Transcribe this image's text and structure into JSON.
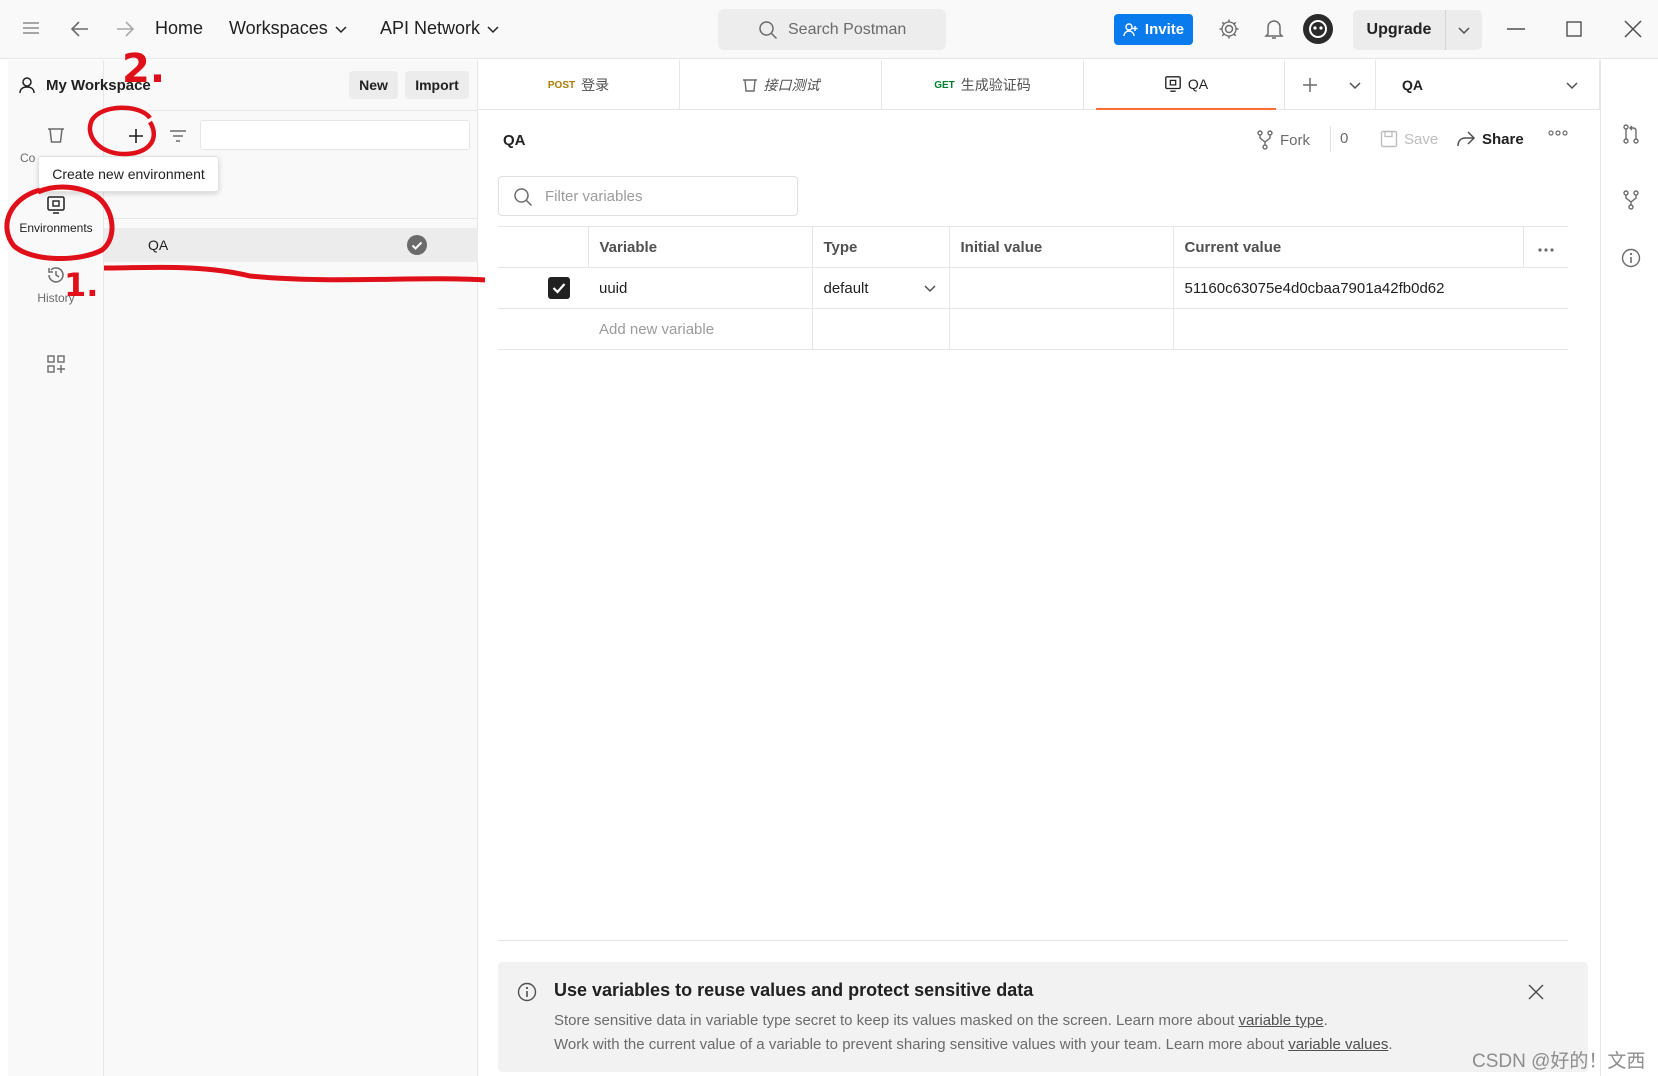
{
  "topbar": {
    "home": "Home",
    "workspaces": "Workspaces",
    "api_network": "API Network",
    "search_placeholder": "Search Postman",
    "invite": "Invite",
    "upgrade": "Upgrade"
  },
  "rail": {
    "collections_partial": "Co",
    "environments": "Environments",
    "history": "History"
  },
  "sidebar": {
    "workspace_title": "My Workspace",
    "new": "New",
    "import": "Import",
    "tooltip": "Create new environment",
    "environments": [
      {
        "name": "QA",
        "active": true
      }
    ]
  },
  "tabs": [
    {
      "method": "POST",
      "method_color": "#ad7a03",
      "label": "登录"
    },
    {
      "method": "",
      "label": "接口测试",
      "icon": "collection-icon"
    },
    {
      "method": "GET",
      "method_color": "#007f31",
      "label": "生成验证码"
    },
    {
      "method": "",
      "label": "QA",
      "icon": "environment-icon",
      "active": true
    }
  ],
  "env_selector": "QA",
  "main": {
    "env_name": "QA",
    "fork": "Fork",
    "fork_count": "0",
    "save": "Save",
    "share": "Share",
    "filter_placeholder": "Filter variables",
    "columns": [
      "Variable",
      "Type",
      "Initial value",
      "Current value"
    ],
    "rows": [
      {
        "checked": true,
        "variable": "uuid",
        "type": "default",
        "initial": "",
        "current": "51160c63075e4d0cbaa7901a42fb0d62"
      }
    ],
    "add_placeholder": "Add new variable"
  },
  "info": {
    "title": "Use variables to reuse values and protect sensitive data",
    "line1_text": "Store sensitive data in variable type secret to keep its values masked on the screen. Learn more about ",
    "line1_link": "variable type",
    "line1_end": ".",
    "line2_text": "Work with the current value of a variable to prevent sharing sensitive values with your team. Learn more about ",
    "line2_link": "variable values",
    "line2_end": "."
  },
  "annotations": {
    "step1": "1.",
    "step2": "2."
  },
  "watermark": "CSDN @好的！文西",
  "colors": {
    "accent": "#ff6c37",
    "invite": "#097bed",
    "annotation": "#e0101a"
  }
}
